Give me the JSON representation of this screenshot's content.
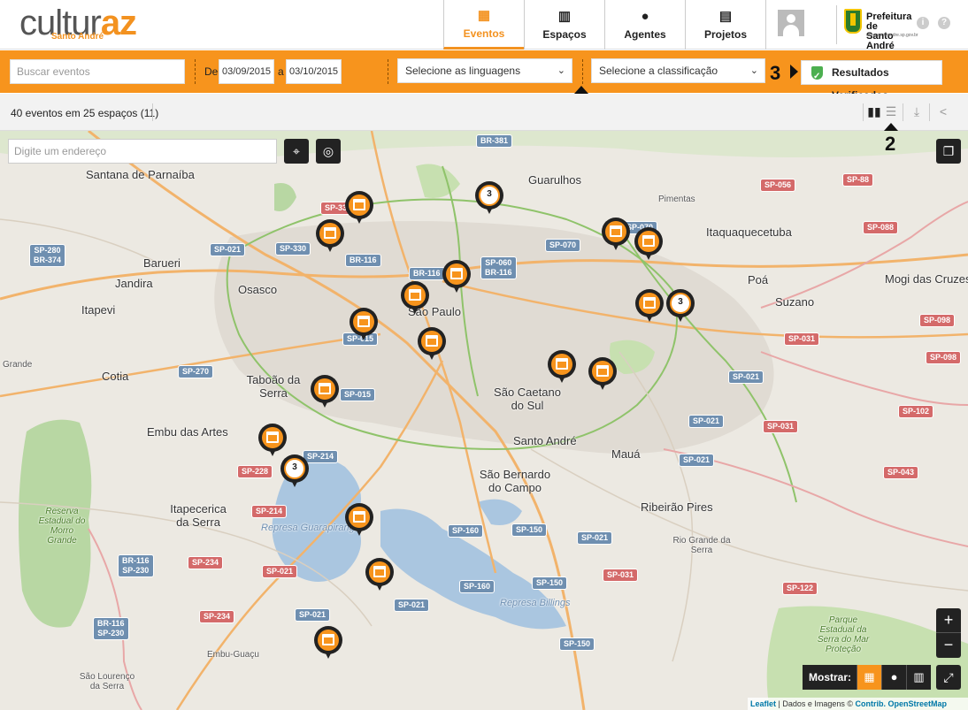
{
  "header": {
    "logo_main": "cultur",
    "logo_accent": "az",
    "logo_sub": "Santo André",
    "nav": [
      {
        "label": "Eventos",
        "icon": "calendar-icon"
      },
      {
        "label": "Espaços",
        "icon": "building-icon"
      },
      {
        "label": "Agentes",
        "icon": "person-icon"
      },
      {
        "label": "Projetos",
        "icon": "document-icon"
      }
    ],
    "active_nav": "Eventos",
    "prefeitura_line1": "Prefeitura de",
    "prefeitura_line2": "Santo André",
    "prefeitura_url": "www.santoandre.sp.gov.br"
  },
  "filters": {
    "search_placeholder": "Buscar eventos",
    "de_label": "De",
    "date_from": "03/09/2015",
    "a_label": "a",
    "date_to": "03/10/2015",
    "linguagens_placeholder": "Selecione as linguagens",
    "classificacao_placeholder": "Selecione a classificação",
    "verified_label": "Resultados Verificados"
  },
  "annotations": {
    "one": "1",
    "two": "2",
    "three": "3"
  },
  "results": {
    "summary": "40 eventos em 25 espaços (11)"
  },
  "map": {
    "address_placeholder": "Digite um endereço",
    "cities": [
      "Santana de Parnaíba",
      "Guarulhos",
      "Itaquaquecetuba",
      "Barueri",
      "Jandira",
      "Osasco",
      "Itapevi",
      "São Paulo",
      "Poá",
      "Suzano",
      "Mogi das Cruzes",
      "Cotia",
      "Taboão da Serra",
      "São Caetano do Sul",
      "Embu das Artes",
      "Santo André",
      "Mauá",
      "São Bernardo do Campo",
      "Itapecerica da Serra",
      "Ribeirão Pires",
      "Rio Grande da Serra",
      "Embu-Guaçu",
      "São Lourenço da Serra",
      "Grande",
      "Pimentas"
    ],
    "water": [
      "Represa Guarapiranga",
      "Represa Billings"
    ],
    "green": [
      "Reserva Estadual do Morro Grande",
      "Parque Estadual da Serra do Mar Proteção"
    ],
    "roads": [
      "BR-381",
      "SP-330",
      "SP-056",
      "SP-88",
      "SP-280",
      "BR-374",
      "SP-021",
      "SP-330",
      "SP-070",
      "SP-070",
      "SP-088",
      "BR-116",
      "SP-060",
      "BR-116",
      "BR-116",
      "SP-015",
      "SP-098",
      "SP-270",
      "SP-031",
      "SP-098",
      "SP-015",
      "SP-021",
      "SP-102",
      "SP-021",
      "SP-031",
      "SP-214",
      "SP-228",
      "SP-021",
      "SP-043",
      "SP-214",
      "SP-160",
      "SP-150",
      "SP-021",
      "BR-116",
      "SP-230",
      "SP-234",
      "SP-021",
      "SP-031",
      "SP-160",
      "SP-150",
      "SP-122",
      "SP-021",
      "SP-234",
      "SP-021",
      "BR-116",
      "SP-230",
      "SP-150"
    ],
    "cluster_counts": [
      "3",
      "3",
      "3"
    ],
    "show_label": "Mostrar:",
    "zoom_in": "+",
    "zoom_out": "−",
    "attribution_leaflet": "Leaflet",
    "attribution_text": " | Dados e Imagens © ",
    "attribution_osm": "Contrib. OpenStreetMap"
  },
  "colors": {
    "accent": "#f7941d",
    "dark": "#222222"
  }
}
